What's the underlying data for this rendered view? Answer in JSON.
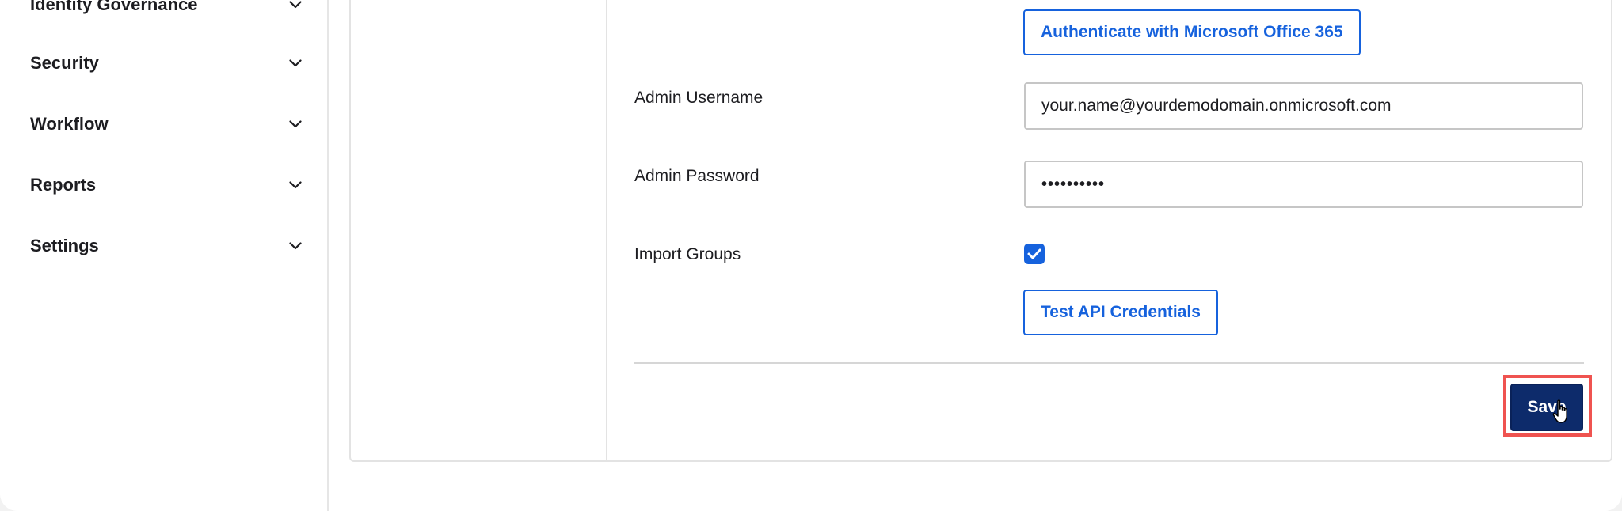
{
  "sidebar": {
    "items": [
      {
        "label": "Identity Governance",
        "icon": "chevron-down-icon"
      },
      {
        "label": "Security",
        "icon": "chevron-down-icon"
      },
      {
        "label": "Workflow",
        "icon": "chevron-down-icon"
      },
      {
        "label": "Reports",
        "icon": "chevron-down-icon"
      },
      {
        "label": "Settings",
        "icon": "chevron-down-icon"
      }
    ]
  },
  "form": {
    "authenticate_button": "Authenticate with Microsoft Office 365",
    "admin_username_label": "Admin Username",
    "admin_username_value": "your.name@yourdemodomain.onmicrosoft.com",
    "admin_password_label": "Admin Password",
    "admin_password_value": "••••••••••",
    "import_groups_label": "Import Groups",
    "import_groups_checked": true,
    "test_api_button": "Test API Credentials",
    "save_button": "Save"
  },
  "colors": {
    "accent": "#1662dd",
    "save_bg": "#0d2b6b",
    "highlight": "#ef5350"
  }
}
